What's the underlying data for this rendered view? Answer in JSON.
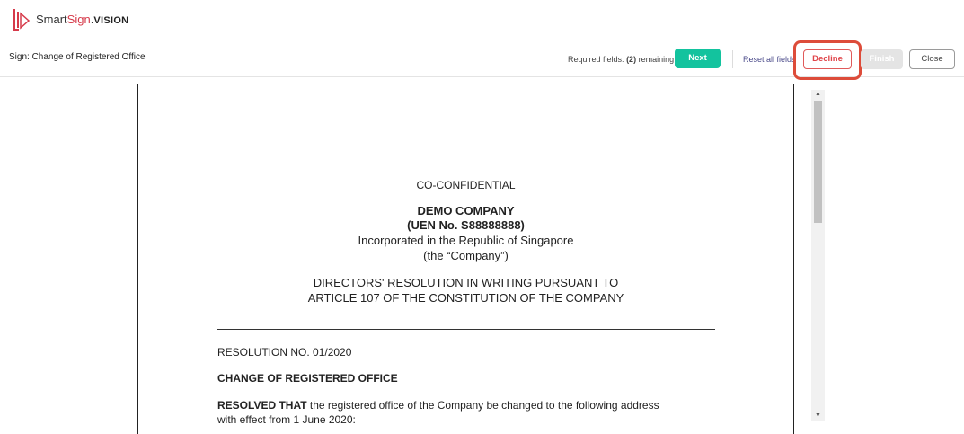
{
  "brand": {
    "part1": "Smart",
    "part2": "Sign",
    "part3": ".",
    "part4": "VISION"
  },
  "toolbar": {
    "doc_title": "Sign: Change of Registered Office",
    "required_prefix": "Required fields:",
    "required_count": "(2)",
    "required_suffix": "remaining",
    "next_label": "Next",
    "reset_label": "Reset all fields",
    "decline_label": "Decline",
    "finish_label": "Finish",
    "close_label": "Close"
  },
  "colors": {
    "accent": "#13c39e",
    "decline": "#e0454a",
    "highlight": "#dd4c3a"
  },
  "document": {
    "confidential": "CO-CONFIDENTIAL",
    "company_name": "DEMO COMPANY",
    "uen": "(UEN No. S88888888)",
    "incorporated": "Incorporated in the Republic of Singapore",
    "company_alias": "(the “Company”)",
    "heading_line1": "DIRECTORS' RESOLUTION IN WRITING PURSUANT TO",
    "heading_line2": "ARTICLE 107 OF THE CONSTITUTION OF THE COMPANY",
    "resolution_no": "RESOLUTION NO. 01/2020",
    "section_title": "CHANGE OF REGISTERED OFFICE",
    "resolved_bold": "RESOLVED THAT",
    "resolved_text": " the registered office of the Company be changed to the following address",
    "resolved_text2": "with effect from 1 June 2020:"
  }
}
